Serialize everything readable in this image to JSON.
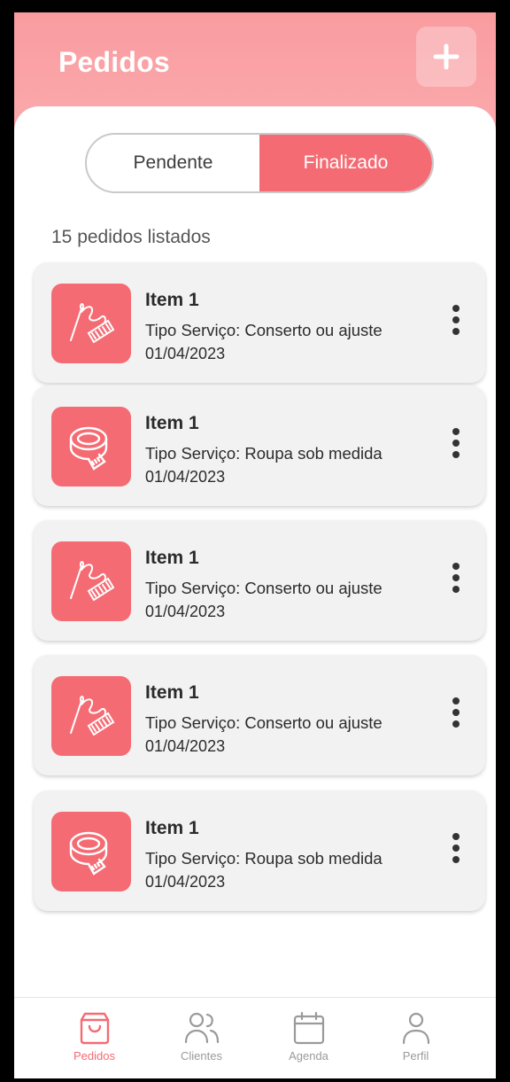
{
  "header": {
    "title": "Pedidos",
    "add_icon": "plus-icon"
  },
  "tabs": [
    {
      "label": "Pendente",
      "active": false
    },
    {
      "label": "Finalizado",
      "active": true
    }
  ],
  "order_count_text": "15 pedidos listados",
  "orders": [
    {
      "title": "Item 1",
      "service_type": "Tipo Serviço: Conserto ou ajuste",
      "date": "01/04/2023",
      "icon": "needle-thread-icon"
    },
    {
      "title": "Item 1",
      "service_type": "Tipo Serviço: Roupa sob medida",
      "date": "01/04/2023",
      "icon": "measuring-tape-icon"
    },
    {
      "title": "Item 1",
      "service_type": "Tipo Serviço: Conserto ou ajuste",
      "date": "01/04/2023",
      "icon": "needle-thread-icon"
    },
    {
      "title": "Item 1",
      "service_type": "Tipo Serviço: Conserto ou ajuste",
      "date": "01/04/2023",
      "icon": "needle-thread-icon"
    },
    {
      "title": "Item 1",
      "service_type": "Tipo Serviço: Roupa sob medida",
      "date": "01/04/2023",
      "icon": "measuring-tape-icon"
    }
  ],
  "bottom_nav": [
    {
      "label": "Pedidos",
      "icon": "shopping-bag-icon",
      "active": true
    },
    {
      "label": "Clientes",
      "icon": "users-icon",
      "active": false
    },
    {
      "label": "Agenda",
      "icon": "calendar-icon",
      "active": false
    },
    {
      "label": "Perfil",
      "icon": "user-icon",
      "active": false
    }
  ],
  "colors": {
    "accent": "#f56b73",
    "header": "#f99ca0",
    "card_bg": "#f2f2f2"
  }
}
